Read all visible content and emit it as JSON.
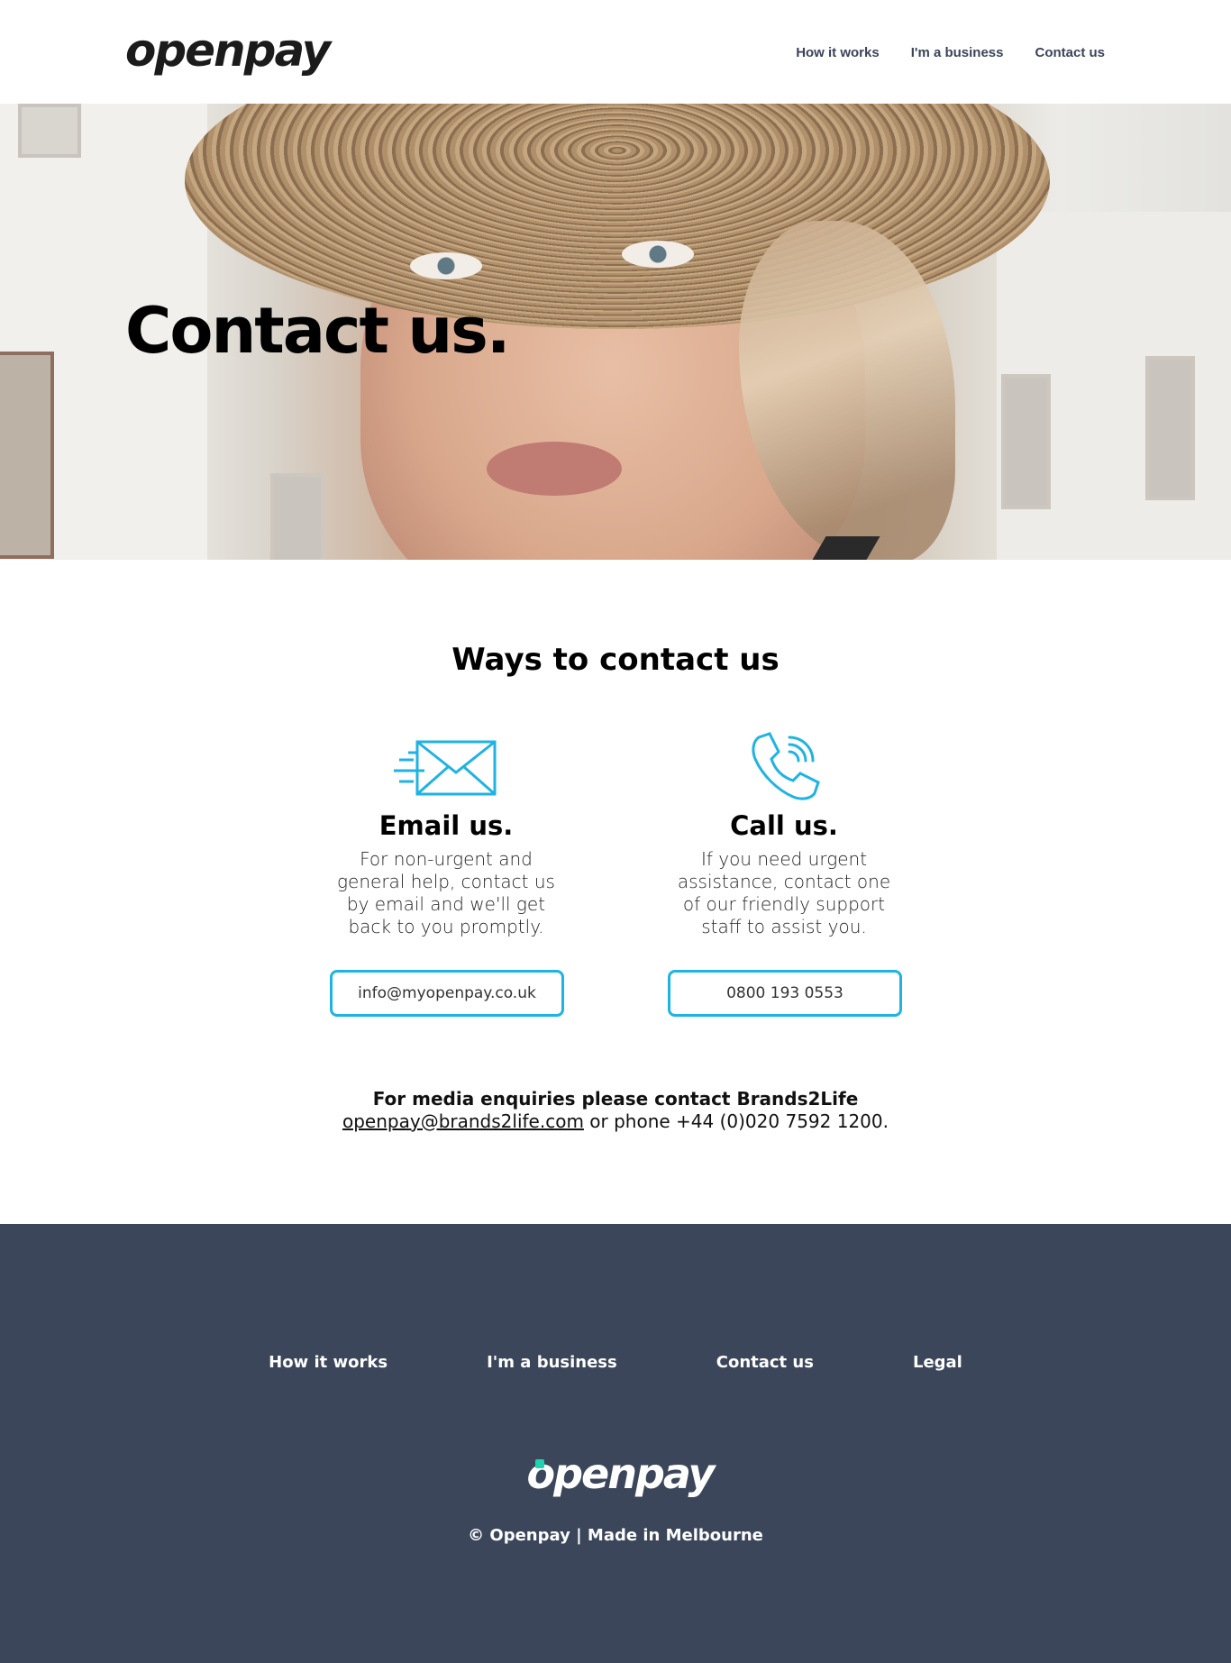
{
  "header": {
    "logo": "openpay",
    "nav": [
      "How it works",
      "I'm a business",
      "Contact us"
    ]
  },
  "hero": {
    "title": "Contact us."
  },
  "contact": {
    "heading": "Ways to contact us",
    "email": {
      "title": "Email us.",
      "text": "For non-urgent and general help, contact us by email and we'll get back to you promptly.",
      "button": "info@myopenpay.co.uk"
    },
    "call": {
      "title": "Call us.",
      "text": "If you need urgent assistance, contact one of our friendly support staff to assist you.",
      "button": "0800 193 0553"
    },
    "media": {
      "line1": "For media enquiries please contact Brands2Life",
      "email": "openpay@brands2life.com",
      "phone_text": " or phone +44 (0)020 7592 1200."
    }
  },
  "footer": {
    "nav": [
      "How it works",
      "I'm a business",
      "Contact us",
      "Legal"
    ],
    "logo": "openpay",
    "copyright": "© Openpay | Made in Melbourne"
  },
  "colors": {
    "accent": "#1fb3e3",
    "footer_bg": "#3b465b",
    "logo_dot": "#1fd3b0"
  }
}
